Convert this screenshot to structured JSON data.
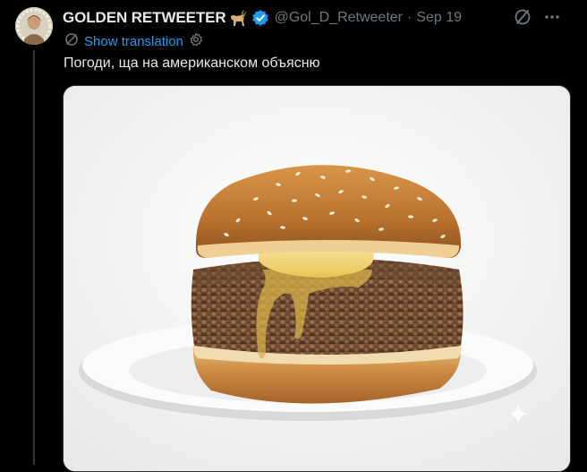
{
  "tweet": {
    "display_name": "GOLDEN RETWEETER",
    "handle": "@Gol_D_Retweeter",
    "separator": "·",
    "date": "Sep 19",
    "translation_label": "Show translation",
    "text": "Погоди, ща на американском объясню"
  },
  "icons": {
    "name_emoji": "goat-emoji-icon",
    "verified": "verified-badge-icon",
    "grok": "grok-icon",
    "more": "more-icon",
    "translate": "translate-icon",
    "settings": "gear-icon",
    "sparkle": "sparkle-watermark-icon"
  },
  "colors": {
    "background": "#000000",
    "text": "#e7e9ea",
    "secondary": "#71767b",
    "link": "#1d9bf0",
    "verified": "#1d9bf0"
  }
}
